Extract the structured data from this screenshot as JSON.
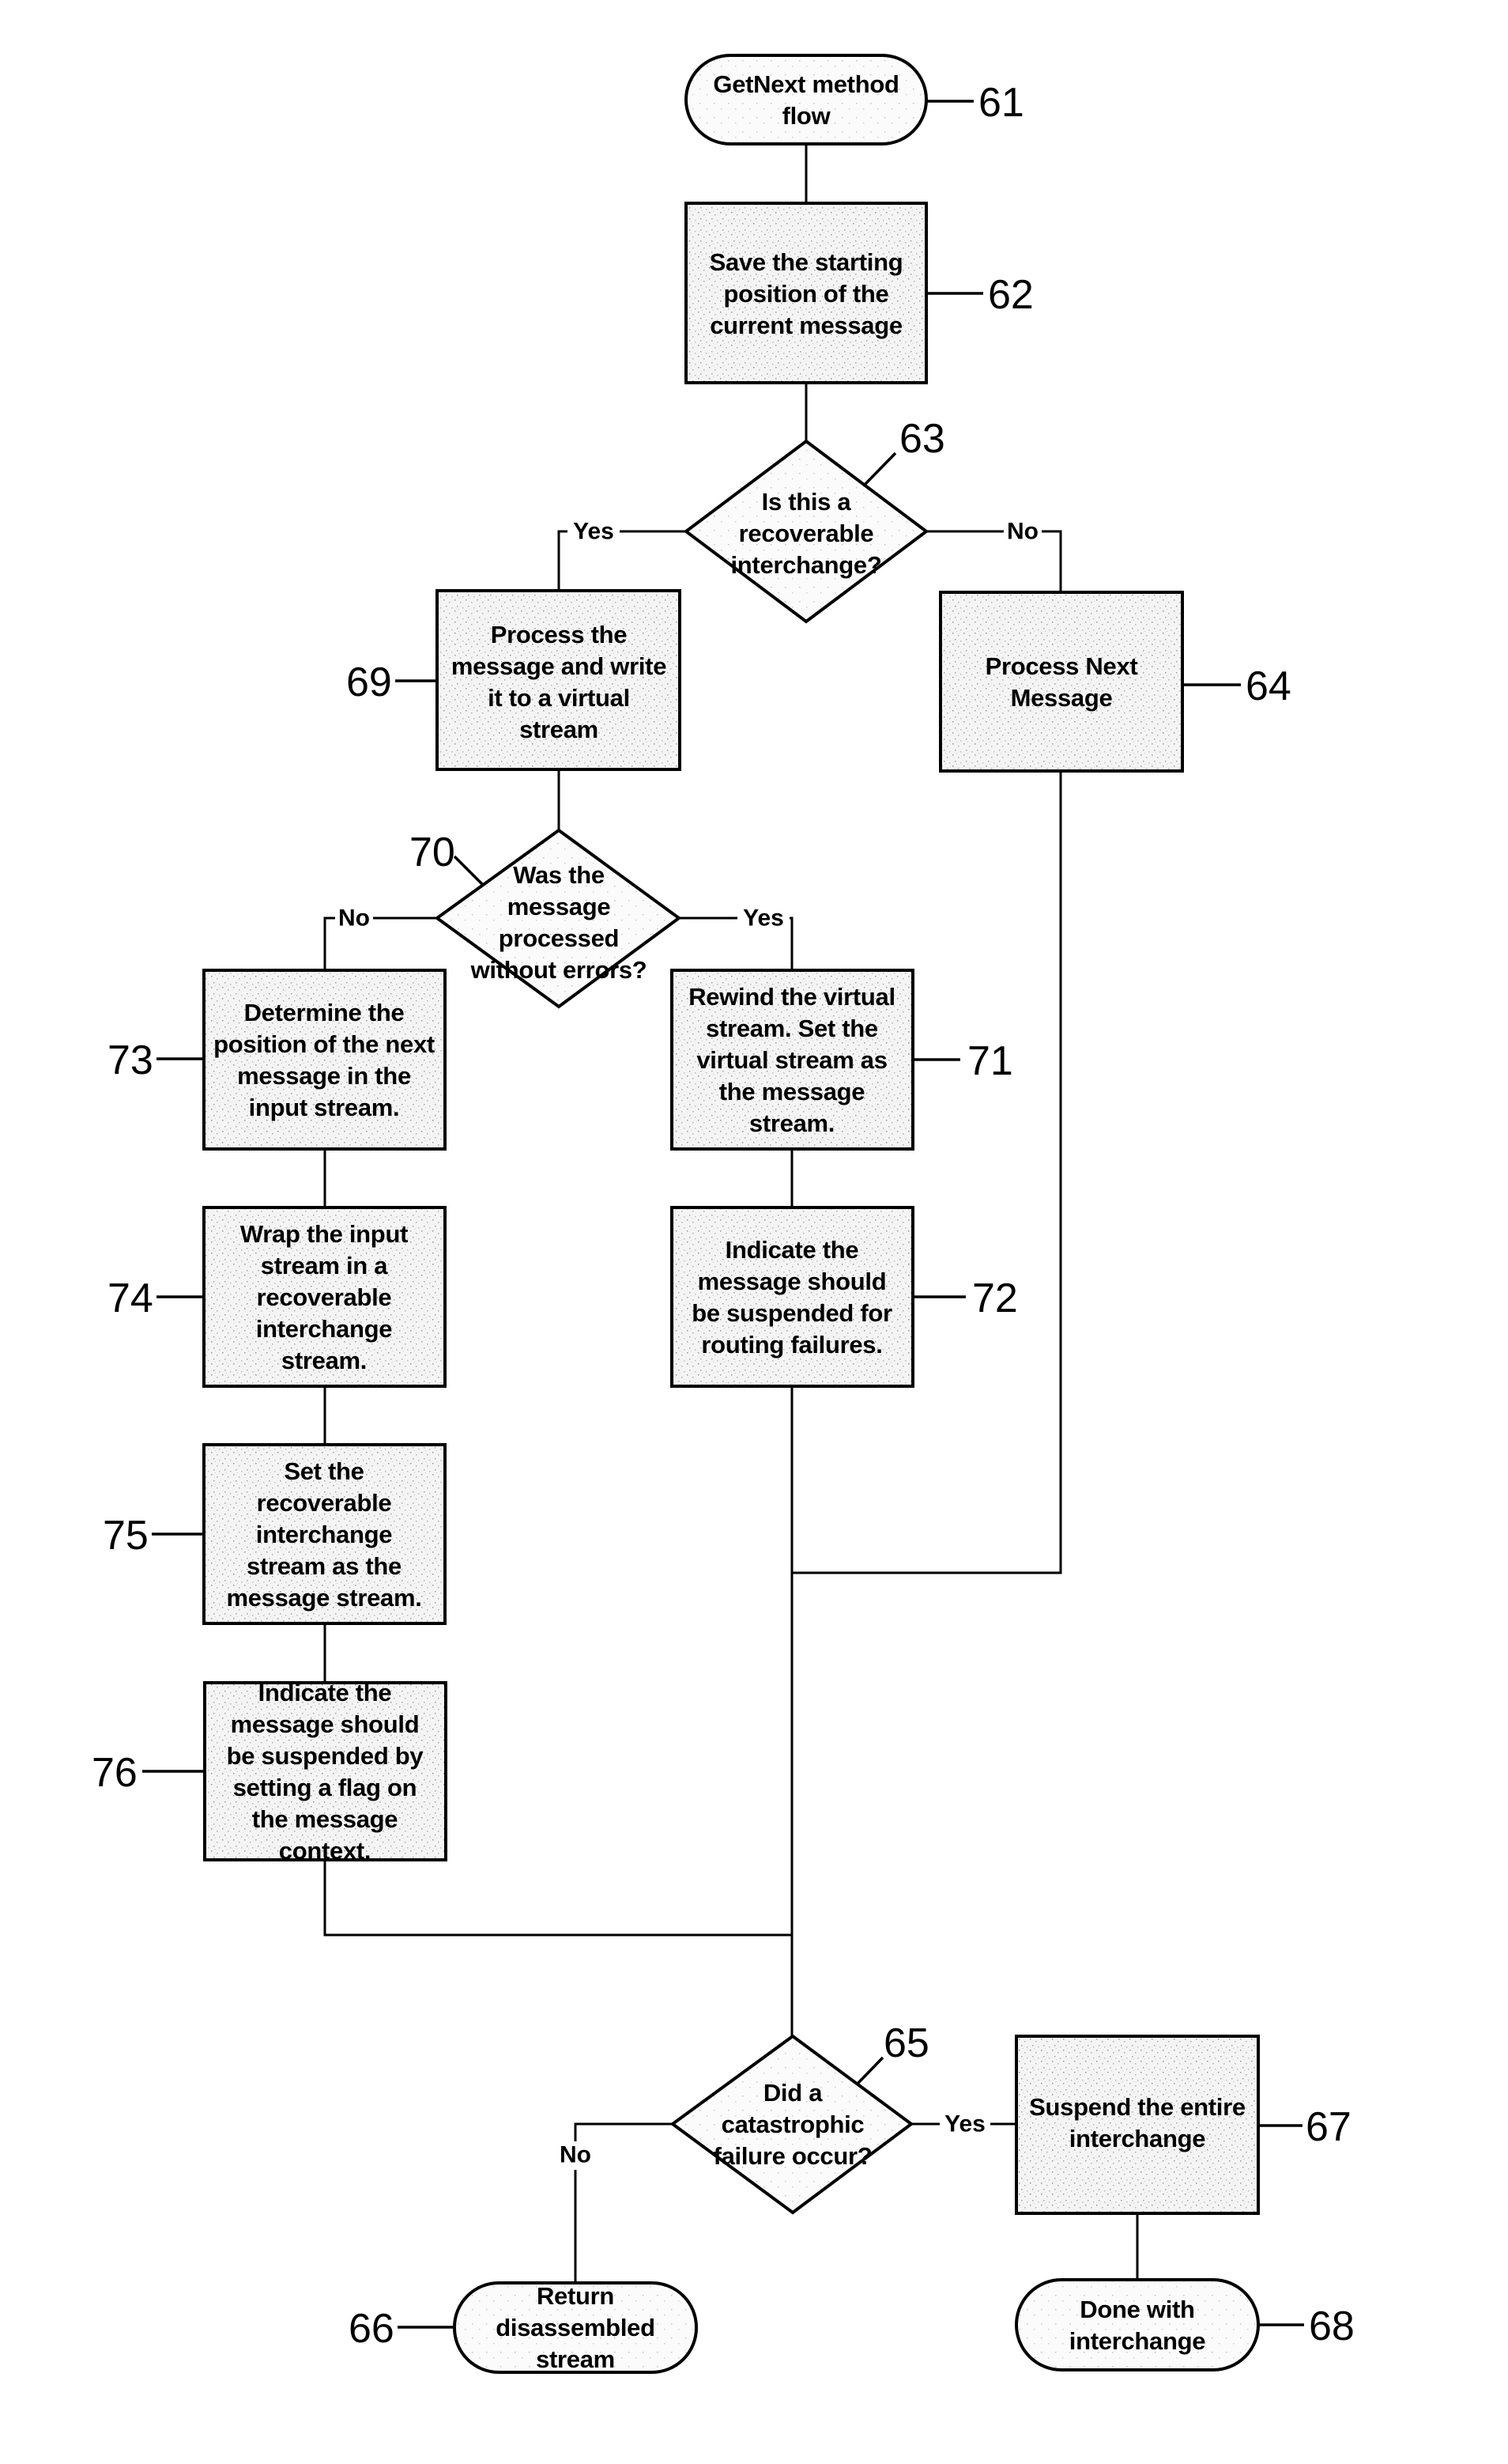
{
  "figure": {
    "type": "flowchart",
    "title": "GetNext method flow"
  },
  "nodes": {
    "n61": {
      "ref": "61",
      "shape": "terminal",
      "lines": [
        "GetNext method",
        "flow"
      ]
    },
    "n62": {
      "ref": "62",
      "shape": "process",
      "lines": [
        "Save the starting",
        "position of the",
        "current message"
      ]
    },
    "n63": {
      "ref": "63",
      "shape": "decision",
      "lines": [
        "Is this a",
        "recoverable",
        "interchange?"
      ]
    },
    "n64": {
      "ref": "64",
      "shape": "process",
      "lines": [
        "Process Next",
        "Message"
      ]
    },
    "n69": {
      "ref": "69",
      "shape": "process",
      "lines": [
        "Process the",
        "message and write",
        "it to a virtual",
        "stream"
      ]
    },
    "n70": {
      "ref": "70",
      "shape": "decision",
      "lines": [
        "Was the",
        "message",
        "processed",
        "without errors?"
      ]
    },
    "n71": {
      "ref": "71",
      "shape": "process",
      "lines": [
        "Rewind the virtual",
        "stream.  Set the",
        "virtual stream as",
        "the message",
        "stream."
      ]
    },
    "n72": {
      "ref": "72",
      "shape": "process",
      "lines": [
        "Indicate the",
        "message should",
        "be suspended for",
        "routing failures."
      ]
    },
    "n73": {
      "ref": "73",
      "shape": "process",
      "lines": [
        "Determine the",
        "position of the next",
        "message in the",
        "input stream."
      ]
    },
    "n74": {
      "ref": "74",
      "shape": "process",
      "lines": [
        "Wrap the input",
        "stream in a",
        "recoverable",
        "interchange",
        "stream."
      ]
    },
    "n75": {
      "ref": "75",
      "shape": "process",
      "lines": [
        "Set the",
        "recoverable",
        "interchange",
        "stream as the",
        "message stream."
      ]
    },
    "n76": {
      "ref": "76",
      "shape": "process",
      "lines": [
        "Indicate the",
        "message should",
        "be suspended by",
        "setting a flag on",
        "the message",
        "context."
      ]
    },
    "n65": {
      "ref": "65",
      "shape": "decision",
      "lines": [
        "Did a",
        "catastrophic",
        "failure occur?"
      ]
    },
    "n66": {
      "ref": "66",
      "shape": "terminal",
      "lines": [
        "Return",
        "disassembled",
        "stream"
      ]
    },
    "n67": {
      "ref": "67",
      "shape": "process",
      "lines": [
        "Suspend the entire",
        "interchange"
      ]
    },
    "n68": {
      "ref": "68",
      "shape": "terminal",
      "lines": [
        "Done with",
        "interchange"
      ]
    }
  },
  "edges": [
    {
      "from": "61",
      "to": "62",
      "label": ""
    },
    {
      "from": "62",
      "to": "63",
      "label": ""
    },
    {
      "from": "63",
      "to": "69",
      "label": "Yes"
    },
    {
      "from": "63",
      "to": "64",
      "label": "No"
    },
    {
      "from": "69",
      "to": "70",
      "label": ""
    },
    {
      "from": "70",
      "to": "73",
      "label": "No"
    },
    {
      "from": "70",
      "to": "71",
      "label": "Yes"
    },
    {
      "from": "73",
      "to": "74",
      "label": ""
    },
    {
      "from": "74",
      "to": "75",
      "label": ""
    },
    {
      "from": "75",
      "to": "76",
      "label": ""
    },
    {
      "from": "71",
      "to": "72",
      "label": ""
    },
    {
      "from": "72",
      "to": "65",
      "label": ""
    },
    {
      "from": "64",
      "to": "65",
      "label": ""
    },
    {
      "from": "76",
      "to": "65",
      "label": ""
    },
    {
      "from": "65",
      "to": "66",
      "label": "No"
    },
    {
      "from": "65",
      "to": "67",
      "label": "Yes"
    },
    {
      "from": "67",
      "to": "68",
      "label": ""
    }
  ],
  "edge_labels": {
    "yes": "Yes",
    "no": "No"
  }
}
